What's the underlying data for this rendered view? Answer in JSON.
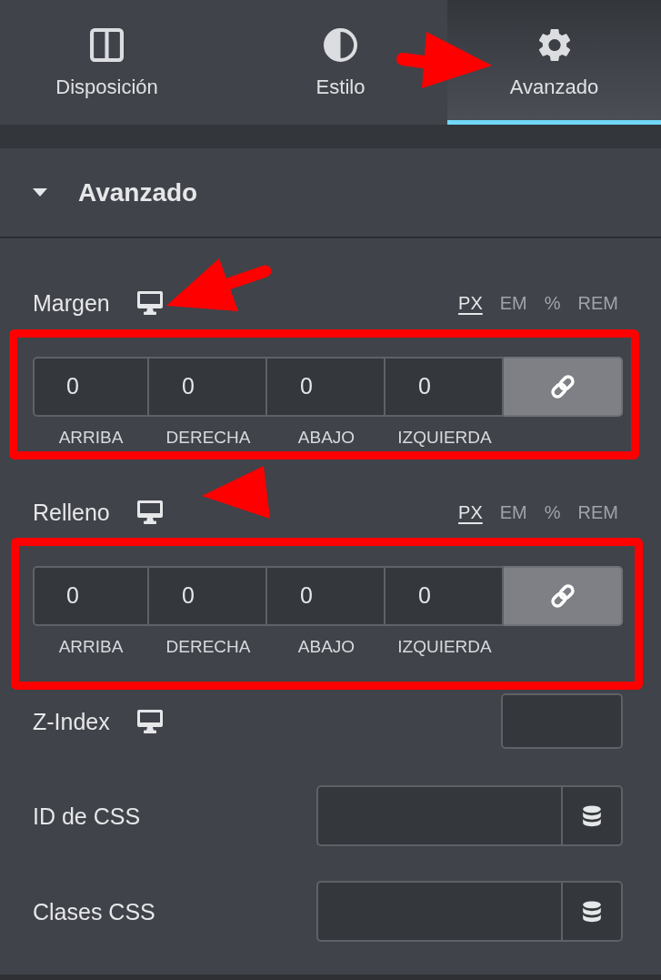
{
  "tabs": [
    {
      "label": "Disposición",
      "kind": "layout",
      "selected": false,
      "annotated": false
    },
    {
      "label": "Estilo",
      "kind": "style",
      "selected": false,
      "annotated": false
    },
    {
      "label": "Avanzado",
      "kind": "advanced",
      "selected": true,
      "annotated": true
    }
  ],
  "section": {
    "title": "Avanzado",
    "expanded": true
  },
  "controls": [
    {
      "kind": "dimensions",
      "label": "Margen",
      "responsive": true,
      "annotation": {
        "kind": "arrow"
      },
      "highlighted": true,
      "units": [
        {
          "label": "PX",
          "selected": true
        },
        {
          "label": "EM",
          "selected": false
        },
        {
          "label": "%",
          "selected": false
        },
        {
          "label": "REM",
          "selected": false
        }
      ],
      "fields": [
        {
          "value": "0",
          "label": "ARRIBA"
        },
        {
          "value": "0",
          "label": "DERECHA"
        },
        {
          "value": "0",
          "label": "ABAJO"
        },
        {
          "value": "0",
          "label": "IZQUIERDA"
        }
      ],
      "linked": true
    },
    {
      "kind": "dimensions",
      "label": "Relleno",
      "responsive": true,
      "annotation": {
        "kind": "arrowhead"
      },
      "highlighted": true,
      "units": [
        {
          "label": "PX",
          "selected": true
        },
        {
          "label": "EM",
          "selected": false
        },
        {
          "label": "%",
          "selected": false
        },
        {
          "label": "REM",
          "selected": false
        }
      ],
      "fields": [
        {
          "value": "0",
          "label": "ARRIBA"
        },
        {
          "value": "0",
          "label": "DERECHA"
        },
        {
          "value": "0",
          "label": "ABAJO"
        },
        {
          "value": "0",
          "label": "IZQUIERDA"
        }
      ],
      "linked": true
    },
    {
      "kind": "number",
      "label": "Z-Index",
      "responsive": true,
      "highlighted": false
    },
    {
      "kind": "text",
      "label": "ID de CSS",
      "responsive": false,
      "highlighted": false
    },
    {
      "kind": "text",
      "label": "Clases CSS",
      "responsive": false,
      "highlighted": false
    }
  ]
}
